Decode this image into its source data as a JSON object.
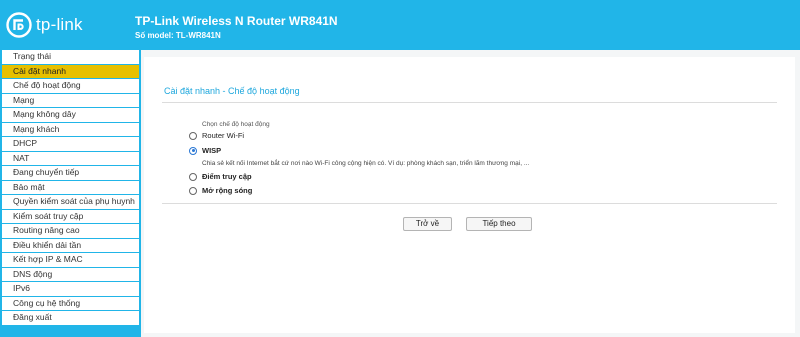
{
  "brand": {
    "name": "tp-link",
    "color": "#21b5e8"
  },
  "header": {
    "title": "TP-Link Wireless N Router WR841N",
    "model": "Số model: TL-WR841N"
  },
  "sidebar": {
    "items": [
      {
        "label": "Trạng thái",
        "active": false
      },
      {
        "label": "Cài đặt nhanh",
        "active": true
      },
      {
        "label": "Chế độ hoạt động",
        "active": false
      },
      {
        "label": "Mạng",
        "active": false
      },
      {
        "label": "Mạng không dây",
        "active": false
      },
      {
        "label": "Mạng khách",
        "active": false
      },
      {
        "label": "DHCP",
        "active": false
      },
      {
        "label": "NAT",
        "active": false
      },
      {
        "label": "Đang chuyển tiếp",
        "active": false
      },
      {
        "label": "Bảo mật",
        "active": false
      },
      {
        "label": "Quyền kiểm soát của phụ huynh",
        "active": false
      },
      {
        "label": "Kiểm soát truy cập",
        "active": false
      },
      {
        "label": "Routing nâng cao",
        "active": false
      },
      {
        "label": "Điều khiển dải tần",
        "active": false
      },
      {
        "label": "Kết hợp IP & MAC",
        "active": false
      },
      {
        "label": "DNS động",
        "active": false
      },
      {
        "label": "IPv6",
        "active": false
      },
      {
        "label": "Công cụ hệ thống",
        "active": false
      },
      {
        "label": "Đăng xuất",
        "active": false
      }
    ]
  },
  "main": {
    "section_title": "Cài đặt nhanh - Chế độ hoạt động",
    "group_label": "Chọn chế độ hoạt động",
    "options": [
      {
        "label": "Router Wi-Fi",
        "checked": false
      },
      {
        "label": "WISP",
        "checked": true
      },
      {
        "label": "Điểm truy cập",
        "checked": false
      },
      {
        "label": "Mở rộng sóng",
        "checked": false
      }
    ],
    "wisp_description": "Chia sẻ kết nối Internet bắt cứ nơi nào Wi-Fi công cộng hiện có. Ví dụ: phòng khách sạn, triển lãm thương mại, ...",
    "back_button": "Trở về",
    "next_button": "Tiếp theo"
  }
}
